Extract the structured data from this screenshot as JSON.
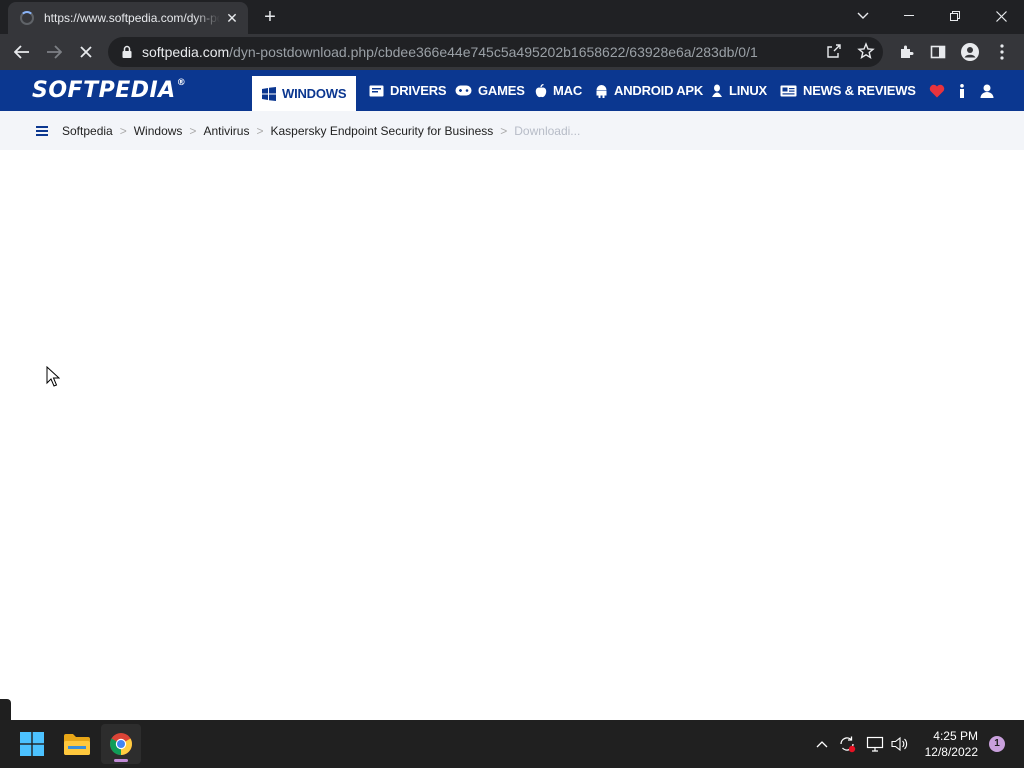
{
  "browser": {
    "tab_title": "https://www.softpedia.com/dyn-postdownload.php",
    "tab_close": "✕",
    "new_tab": "+",
    "url_host": "softpedia.com",
    "url_path": "/dyn-postdownload.php/cbdee366e44e745c5a495202b1658622/63928e6a/283db/0/1",
    "accent": "#8ab4f8"
  },
  "site": {
    "logo": "SOFTPEDIA",
    "logo_mark": "®",
    "brand_color": "#0b3790",
    "nav": {
      "windows": "WINDOWS",
      "drivers": "DRIVERS",
      "games": "GAMES",
      "mac": "MAC",
      "android": "ANDROID APK",
      "linux": "LINUX",
      "news": "NEWS & REVIEWS"
    },
    "breadcrumb": {
      "home": "Softpedia",
      "windows": "Windows",
      "antivirus": "Antivirus",
      "product": "Kaspersky Endpoint Security for Business",
      "current": "Downloadi...",
      "separator": ">"
    }
  },
  "taskbar": {
    "time": "4:25 PM",
    "date": "12/8/2022",
    "notifications": "1"
  }
}
